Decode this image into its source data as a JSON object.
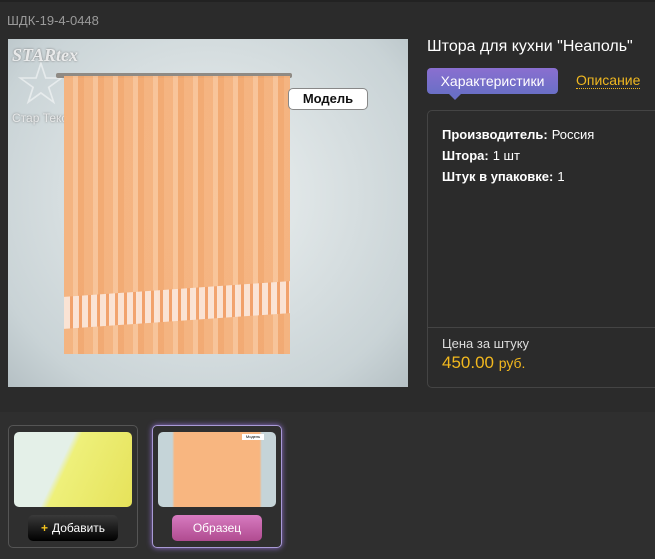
{
  "sku": "ШДК-19-4-0448",
  "photo": {
    "badge": "Модель",
    "watermark": "STARtex",
    "watermark_sub": "Стар Текс"
  },
  "title": "Штора для кухни \"Неаполь\"",
  "tabs": {
    "active": "Характеристики",
    "other": "Описание"
  },
  "specs": [
    {
      "label": "Производитель:",
      "value": "Россия"
    },
    {
      "label": "Штора:",
      "value": "1 шт"
    },
    {
      "label": "Штук в упаковке:",
      "value": "1"
    }
  ],
  "price": {
    "label": "Цена за штуку",
    "value": "450.00",
    "currency": "руб."
  },
  "thumbs": [
    {
      "button": "Добавить",
      "icon": "+"
    },
    {
      "button": "Образец",
      "badge": "Модель"
    }
  ]
}
